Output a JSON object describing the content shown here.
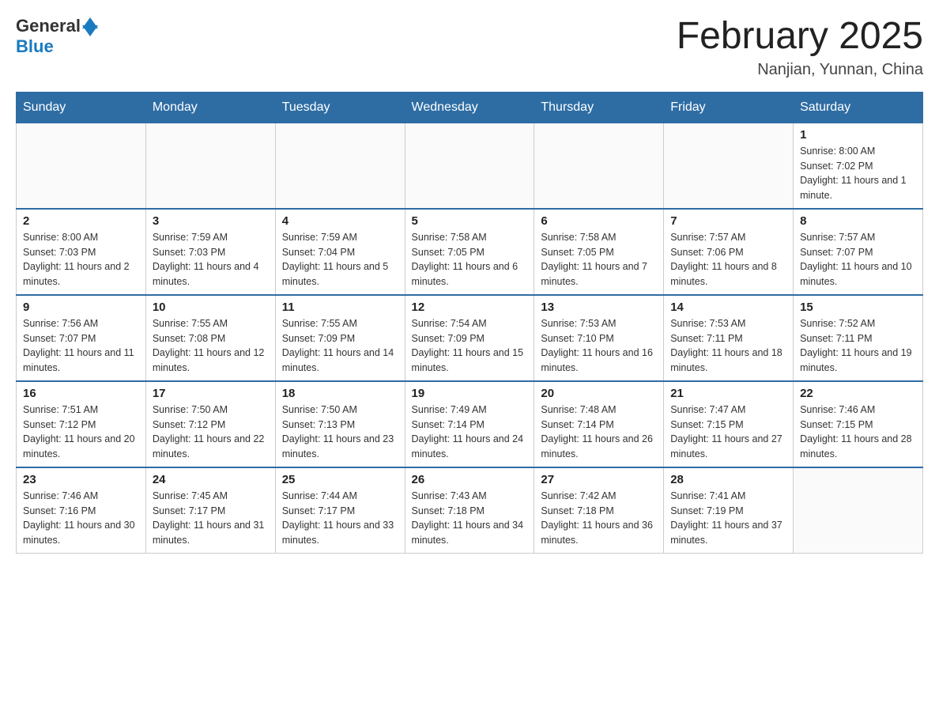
{
  "header": {
    "logo": {
      "general": "General",
      "blue": "Blue"
    },
    "title": "February 2025",
    "location": "Nanjian, Yunnan, China"
  },
  "days_of_week": [
    "Sunday",
    "Monday",
    "Tuesday",
    "Wednesday",
    "Thursday",
    "Friday",
    "Saturday"
  ],
  "weeks": [
    [
      {
        "day": "",
        "info": ""
      },
      {
        "day": "",
        "info": ""
      },
      {
        "day": "",
        "info": ""
      },
      {
        "day": "",
        "info": ""
      },
      {
        "day": "",
        "info": ""
      },
      {
        "day": "",
        "info": ""
      },
      {
        "day": "1",
        "info": "Sunrise: 8:00 AM\nSunset: 7:02 PM\nDaylight: 11 hours and 1 minute."
      }
    ],
    [
      {
        "day": "2",
        "info": "Sunrise: 8:00 AM\nSunset: 7:03 PM\nDaylight: 11 hours and 2 minutes."
      },
      {
        "day": "3",
        "info": "Sunrise: 7:59 AM\nSunset: 7:03 PM\nDaylight: 11 hours and 4 minutes."
      },
      {
        "day": "4",
        "info": "Sunrise: 7:59 AM\nSunset: 7:04 PM\nDaylight: 11 hours and 5 minutes."
      },
      {
        "day": "5",
        "info": "Sunrise: 7:58 AM\nSunset: 7:05 PM\nDaylight: 11 hours and 6 minutes."
      },
      {
        "day": "6",
        "info": "Sunrise: 7:58 AM\nSunset: 7:05 PM\nDaylight: 11 hours and 7 minutes."
      },
      {
        "day": "7",
        "info": "Sunrise: 7:57 AM\nSunset: 7:06 PM\nDaylight: 11 hours and 8 minutes."
      },
      {
        "day": "8",
        "info": "Sunrise: 7:57 AM\nSunset: 7:07 PM\nDaylight: 11 hours and 10 minutes."
      }
    ],
    [
      {
        "day": "9",
        "info": "Sunrise: 7:56 AM\nSunset: 7:07 PM\nDaylight: 11 hours and 11 minutes."
      },
      {
        "day": "10",
        "info": "Sunrise: 7:55 AM\nSunset: 7:08 PM\nDaylight: 11 hours and 12 minutes."
      },
      {
        "day": "11",
        "info": "Sunrise: 7:55 AM\nSunset: 7:09 PM\nDaylight: 11 hours and 14 minutes."
      },
      {
        "day": "12",
        "info": "Sunrise: 7:54 AM\nSunset: 7:09 PM\nDaylight: 11 hours and 15 minutes."
      },
      {
        "day": "13",
        "info": "Sunrise: 7:53 AM\nSunset: 7:10 PM\nDaylight: 11 hours and 16 minutes."
      },
      {
        "day": "14",
        "info": "Sunrise: 7:53 AM\nSunset: 7:11 PM\nDaylight: 11 hours and 18 minutes."
      },
      {
        "day": "15",
        "info": "Sunrise: 7:52 AM\nSunset: 7:11 PM\nDaylight: 11 hours and 19 minutes."
      }
    ],
    [
      {
        "day": "16",
        "info": "Sunrise: 7:51 AM\nSunset: 7:12 PM\nDaylight: 11 hours and 20 minutes."
      },
      {
        "day": "17",
        "info": "Sunrise: 7:50 AM\nSunset: 7:12 PM\nDaylight: 11 hours and 22 minutes."
      },
      {
        "day": "18",
        "info": "Sunrise: 7:50 AM\nSunset: 7:13 PM\nDaylight: 11 hours and 23 minutes."
      },
      {
        "day": "19",
        "info": "Sunrise: 7:49 AM\nSunset: 7:14 PM\nDaylight: 11 hours and 24 minutes."
      },
      {
        "day": "20",
        "info": "Sunrise: 7:48 AM\nSunset: 7:14 PM\nDaylight: 11 hours and 26 minutes."
      },
      {
        "day": "21",
        "info": "Sunrise: 7:47 AM\nSunset: 7:15 PM\nDaylight: 11 hours and 27 minutes."
      },
      {
        "day": "22",
        "info": "Sunrise: 7:46 AM\nSunset: 7:15 PM\nDaylight: 11 hours and 28 minutes."
      }
    ],
    [
      {
        "day": "23",
        "info": "Sunrise: 7:46 AM\nSunset: 7:16 PM\nDaylight: 11 hours and 30 minutes."
      },
      {
        "day": "24",
        "info": "Sunrise: 7:45 AM\nSunset: 7:17 PM\nDaylight: 11 hours and 31 minutes."
      },
      {
        "day": "25",
        "info": "Sunrise: 7:44 AM\nSunset: 7:17 PM\nDaylight: 11 hours and 33 minutes."
      },
      {
        "day": "26",
        "info": "Sunrise: 7:43 AM\nSunset: 7:18 PM\nDaylight: 11 hours and 34 minutes."
      },
      {
        "day": "27",
        "info": "Sunrise: 7:42 AM\nSunset: 7:18 PM\nDaylight: 11 hours and 36 minutes."
      },
      {
        "day": "28",
        "info": "Sunrise: 7:41 AM\nSunset: 7:19 PM\nDaylight: 11 hours and 37 minutes."
      },
      {
        "day": "",
        "info": ""
      }
    ]
  ]
}
